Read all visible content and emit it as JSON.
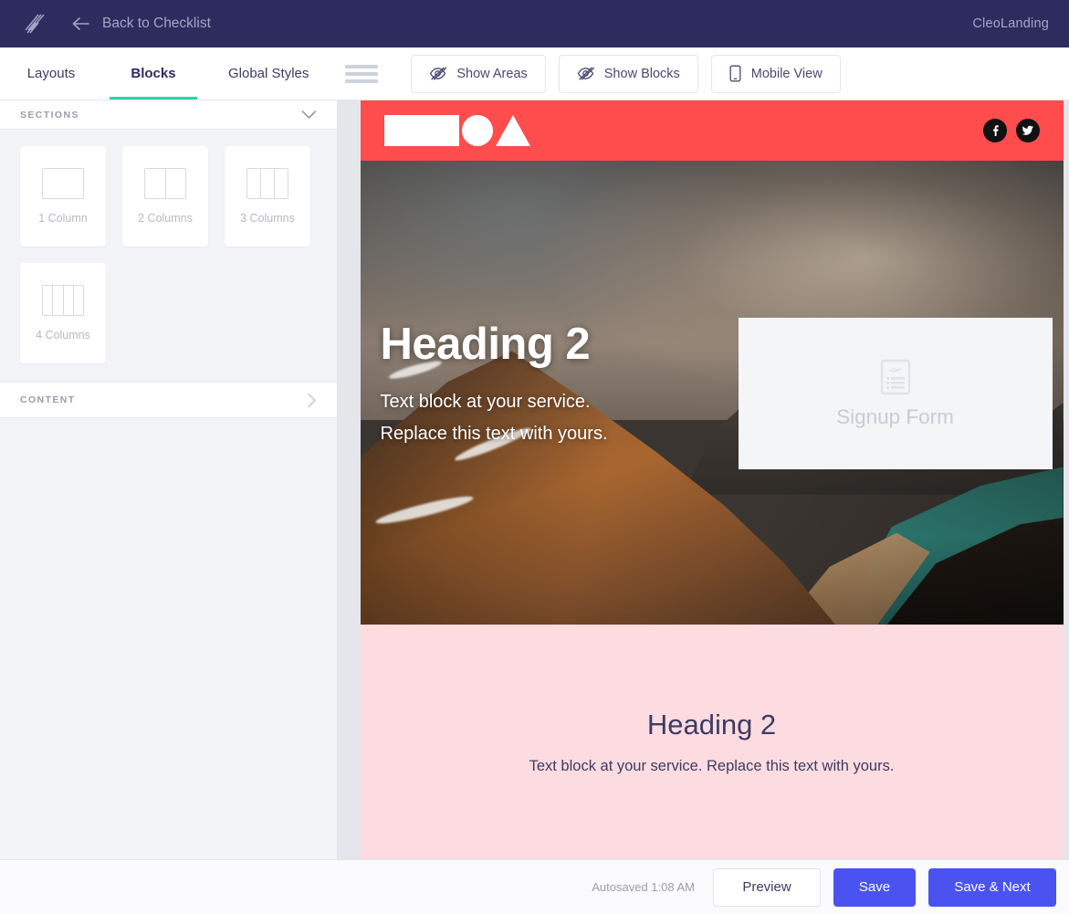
{
  "topbar": {
    "logo_icon": "slashes-logo-icon",
    "back_icon": "arrow-left-icon",
    "back_label": "Back to Checklist",
    "project_name": "CleoLanding"
  },
  "toolbar": {
    "tabs": [
      {
        "label": "Layouts",
        "active": false
      },
      {
        "label": "Blocks",
        "active": true
      },
      {
        "label": "Global Styles",
        "active": false
      }
    ],
    "menu_icon": "hamburger-icon",
    "buttons": [
      {
        "label": "Show Areas",
        "icon": "eye-off-icon"
      },
      {
        "label": "Show Blocks",
        "icon": "eye-off-icon"
      },
      {
        "label": "Mobile View",
        "icon": "mobile-phone-icon"
      }
    ]
  },
  "sidebar": {
    "sections_panel": {
      "title": "SECTIONS",
      "chevron_icon": "chevron-down-icon",
      "expanded": true,
      "items": [
        {
          "label": "1 Column",
          "columns": 1
        },
        {
          "label": "2 Columns",
          "columns": 2
        },
        {
          "label": "3 Columns",
          "columns": 3
        },
        {
          "label": "4 Columns",
          "columns": 4
        }
      ]
    },
    "content_panel": {
      "title": "CONTENT",
      "chevron_icon": "chevron-right-icon",
      "expanded": false
    }
  },
  "canvas": {
    "site_header": {
      "logo_shapes": [
        "rectangle",
        "circle",
        "triangle"
      ],
      "background_color": "#FF4C4C",
      "socials": [
        {
          "name": "facebook-icon",
          "glyph": "f"
        },
        {
          "name": "twitter-icon",
          "glyph": "twitter"
        }
      ]
    },
    "hero": {
      "heading": "Heading 2",
      "paragraph_line1": "Text block at your service.",
      "paragraph_line2": "Replace this text with yours.",
      "signup_block": {
        "icon": "form-document-icon",
        "label": "Signup Form"
      }
    },
    "pink_section": {
      "background_color": "#FDDCE1",
      "heading": "Heading 2",
      "paragraph": "Text block at your service. Replace this text with yours."
    }
  },
  "bottombar": {
    "autosave_text": "Autosaved 1:08 AM",
    "preview_label": "Preview",
    "save_label": "Save",
    "save_next_label": "Save & Next"
  },
  "colors": {
    "topbar": "#2E2B5F",
    "accent_green": "#2ED3A2",
    "primary_blue": "#4A52F0",
    "site_red": "#FF4C4C",
    "pink": "#FDDCE1"
  }
}
